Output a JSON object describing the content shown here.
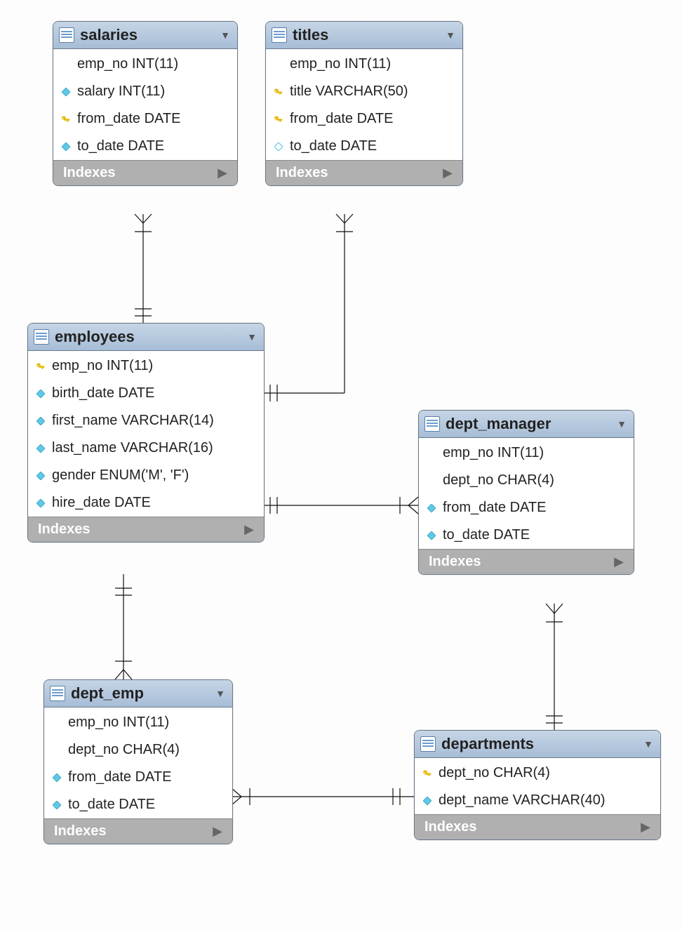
{
  "tables": {
    "salaries": {
      "name": "salaries",
      "columns": [
        {
          "icon": "none",
          "text": "emp_no INT(11)"
        },
        {
          "icon": "diamond_fill",
          "text": "salary INT(11)"
        },
        {
          "icon": "key",
          "text": "from_date DATE"
        },
        {
          "icon": "diamond_fill",
          "text": "to_date DATE"
        }
      ],
      "indexes_label": "Indexes"
    },
    "titles": {
      "name": "titles",
      "columns": [
        {
          "icon": "none",
          "text": "emp_no INT(11)"
        },
        {
          "icon": "key",
          "text": "title VARCHAR(50)"
        },
        {
          "icon": "key",
          "text": "from_date DATE"
        },
        {
          "icon": "diamond_empty",
          "text": "to_date DATE"
        }
      ],
      "indexes_label": "Indexes"
    },
    "employees": {
      "name": "employees",
      "columns": [
        {
          "icon": "key",
          "text": "emp_no INT(11)"
        },
        {
          "icon": "diamond_fill",
          "text": "birth_date DATE"
        },
        {
          "icon": "diamond_fill",
          "text": "first_name VARCHAR(14)"
        },
        {
          "icon": "diamond_fill",
          "text": "last_name VARCHAR(16)"
        },
        {
          "icon": "diamond_fill",
          "text": "gender ENUM('M', 'F')"
        },
        {
          "icon": "diamond_fill",
          "text": "hire_date DATE"
        }
      ],
      "indexes_label": "Indexes"
    },
    "dept_manager": {
      "name": "dept_manager",
      "columns": [
        {
          "icon": "none",
          "text": "emp_no INT(11)"
        },
        {
          "icon": "none",
          "text": "dept_no CHAR(4)"
        },
        {
          "icon": "diamond_fill",
          "text": "from_date DATE"
        },
        {
          "icon": "diamond_fill",
          "text": "to_date DATE"
        }
      ],
      "indexes_label": "Indexes"
    },
    "dept_emp": {
      "name": "dept_emp",
      "columns": [
        {
          "icon": "none",
          "text": "emp_no INT(11)"
        },
        {
          "icon": "none",
          "text": "dept_no CHAR(4)"
        },
        {
          "icon": "diamond_fill",
          "text": "from_date DATE"
        },
        {
          "icon": "diamond_fill",
          "text": "to_date DATE"
        }
      ],
      "indexes_label": "Indexes"
    },
    "departments": {
      "name": "departments",
      "columns": [
        {
          "icon": "key",
          "text": "dept_no CHAR(4)"
        },
        {
          "icon": "diamond_fill",
          "text": "dept_name VARCHAR(40)"
        }
      ],
      "indexes_label": "Indexes"
    }
  },
  "relationships": [
    {
      "from": "salaries",
      "to": "employees",
      "type": "many-to-one"
    },
    {
      "from": "titles",
      "to": "employees",
      "type": "many-to-one"
    },
    {
      "from": "dept_manager",
      "to": "employees",
      "type": "many-to-one"
    },
    {
      "from": "dept_emp",
      "to": "employees",
      "type": "many-to-one"
    },
    {
      "from": "dept_manager",
      "to": "departments",
      "type": "many-to-one"
    },
    {
      "from": "dept_emp",
      "to": "departments",
      "type": "many-to-one"
    }
  ]
}
